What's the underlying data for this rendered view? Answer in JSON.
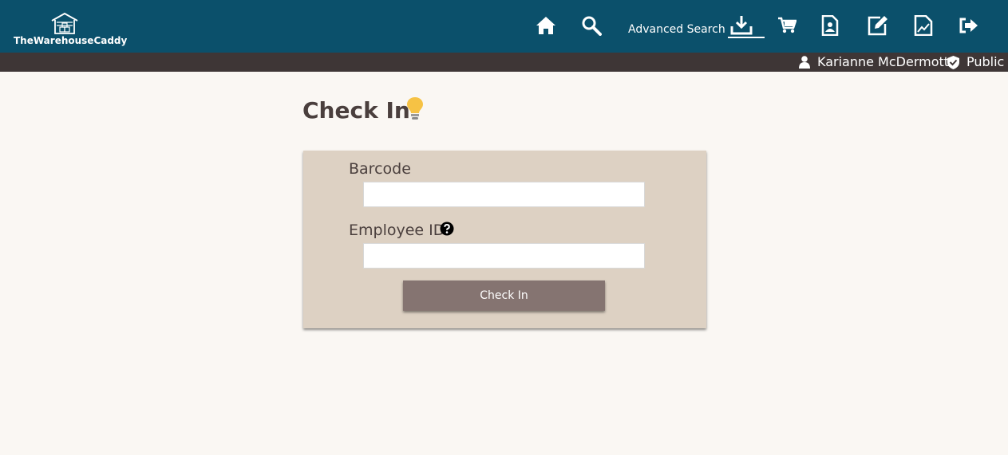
{
  "app": {
    "logo_text": "TheWarehouseCaddy"
  },
  "nav": {
    "items": [
      {
        "icon": "home-icon",
        "label": ""
      },
      {
        "icon": "search-icon",
        "label": ""
      },
      {
        "icon": "advanced-search",
        "label": "Advanced Search"
      },
      {
        "icon": "check-in-icon",
        "label": "",
        "active": true
      },
      {
        "icon": "cart-icon",
        "label": ""
      },
      {
        "icon": "document-icon",
        "label": ""
      },
      {
        "icon": "edit-icon",
        "label": ""
      },
      {
        "icon": "report-icon",
        "label": ""
      },
      {
        "icon": "logout-icon",
        "label": ""
      }
    ]
  },
  "user": {
    "name": "Karianne McDermott",
    "role": "Public"
  },
  "page": {
    "title": "Check In"
  },
  "form": {
    "barcode_label": "Barcode",
    "barcode_value": "",
    "employee_label": "Employee ID",
    "employee_value": "",
    "submit_label": "Check In"
  },
  "colors": {
    "header": "#0b506b",
    "userbar": "#3e3636",
    "card": "#ddd1c3",
    "button": "#857471",
    "background": "#faf7f3"
  }
}
